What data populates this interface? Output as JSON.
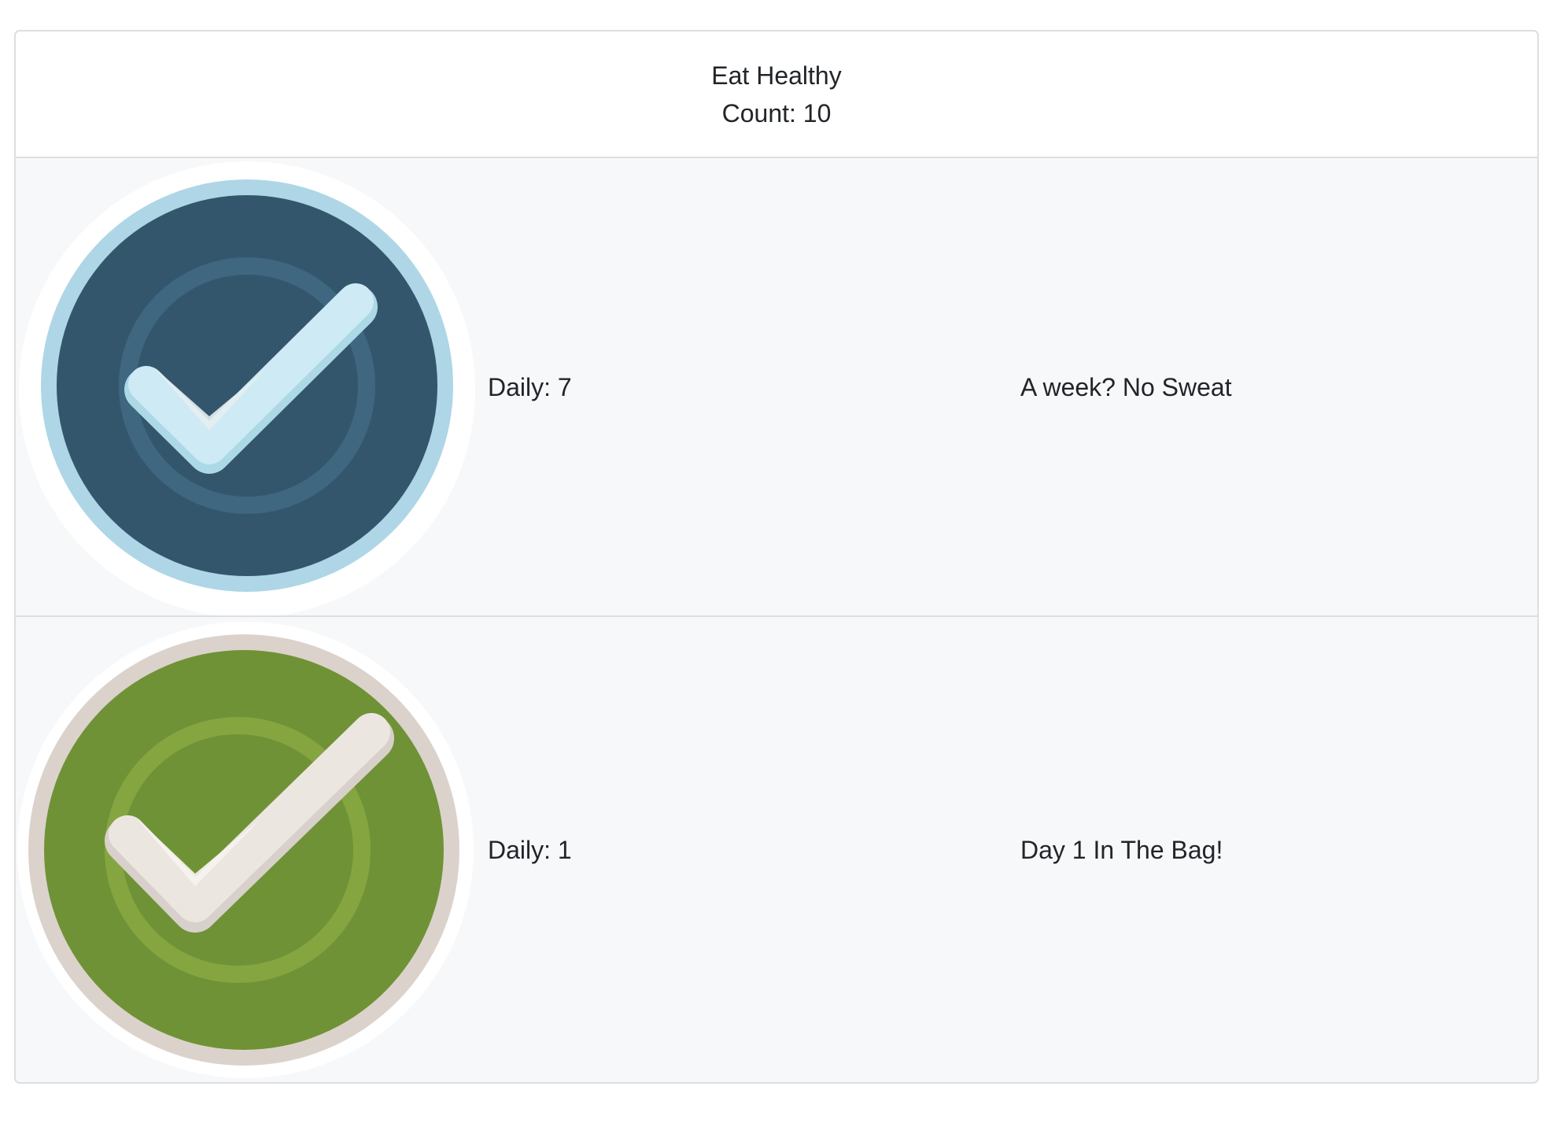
{
  "goal": {
    "title": "Eat Healthy",
    "count_text": "Count: 10"
  },
  "badges": [
    {
      "daily_text": "Daily: 7",
      "message": "A week? No Sweat",
      "icon": "check-badge-icon",
      "colors": {
        "outer": "#aed6e6",
        "inner": "#34566d",
        "ring": "#3f6780",
        "check": "#cdeaf5",
        "check_shadow": "#add8e6"
      }
    },
    {
      "daily_text": "Daily: 1",
      "message": "Day 1 In The Bag!",
      "icon": "check-badge-icon",
      "colors": {
        "outer": "#dbd2cc",
        "inner": "#709236",
        "ring": "#85a541",
        "check": "#ece6e1",
        "check_shadow": "#d8d0ca"
      }
    }
  ]
}
